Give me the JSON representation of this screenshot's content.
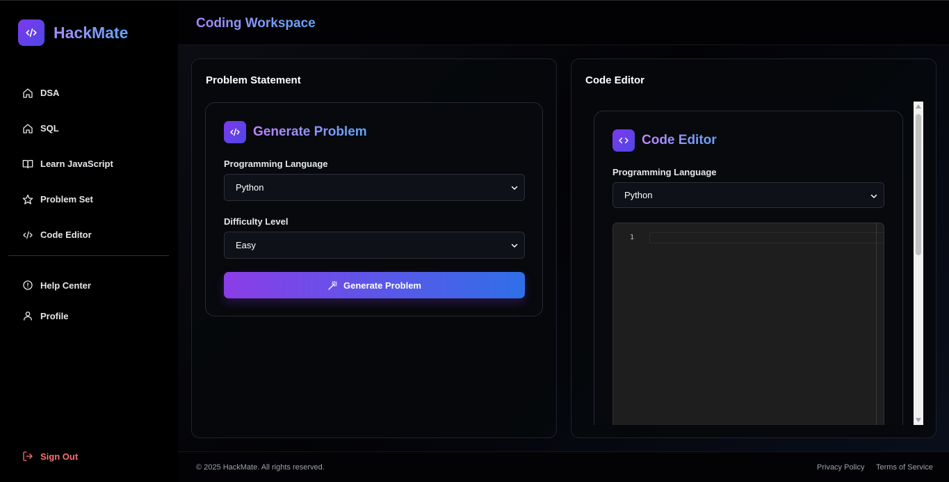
{
  "brand": {
    "name": "HackMate",
    "logo_icon": "code-icon"
  },
  "sidebar": {
    "items": [
      {
        "label": "DSA",
        "icon": "home-icon"
      },
      {
        "label": "SQL",
        "icon": "home-icon"
      },
      {
        "label": "Learn JavaScript",
        "icon": "book-icon"
      },
      {
        "label": "Problem Set",
        "icon": "star-icon"
      },
      {
        "label": "Code Editor",
        "icon": "code-icon"
      }
    ],
    "secondary": [
      {
        "label": "Help Center",
        "icon": "alert-circle-icon"
      },
      {
        "label": "Profile",
        "icon": "user-icon"
      }
    ],
    "signout": "Sign Out"
  },
  "header": {
    "title": "Coding Workspace"
  },
  "problem_panel": {
    "title": "Problem Statement",
    "card_title": "Generate Problem",
    "language_label": "Programming Language",
    "language_value": "Python",
    "difficulty_label": "Difficulty Level",
    "difficulty_value": "Easy",
    "button_label": "Generate Problem"
  },
  "editor_panel": {
    "title": "Code Editor",
    "card_title": "Code Editor",
    "language_label": "Programming Language",
    "language_value": "Python",
    "line_number": "1"
  },
  "footer": {
    "copyright": "© 2025 HackMate. All rights reserved.",
    "privacy": "Privacy Policy",
    "terms": "Terms of Service"
  },
  "colors": {
    "accent_start": "#8b3de8",
    "accent_end": "#2f6fe8",
    "danger": "#f87171"
  }
}
